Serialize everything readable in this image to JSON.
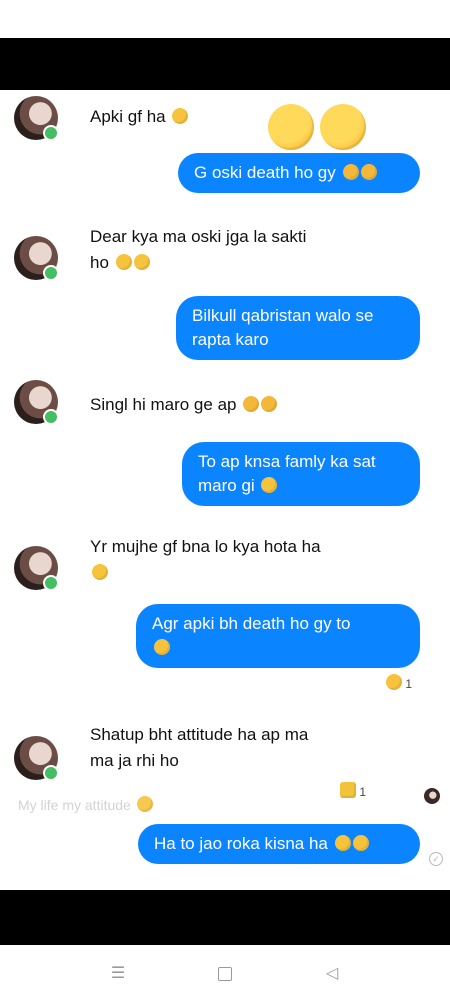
{
  "messages": [
    {
      "id": "m1",
      "side": "in",
      "text": "Apki gf ha"
    },
    {
      "id": "m2",
      "side": "out",
      "text": "G oski death ho gy"
    },
    {
      "id": "m3",
      "side": "in",
      "line1": "Dear kya ma oski jga la sakti",
      "line2": "ho"
    },
    {
      "id": "m4",
      "side": "out",
      "line1": "Bilkull qabristan walo se",
      "line2": "rapta karo"
    },
    {
      "id": "m5",
      "side": "in",
      "text": "Singl hi maro ge ap"
    },
    {
      "id": "m6",
      "side": "out",
      "line1": "To ap knsa famly ka sat",
      "line2": "maro gi"
    },
    {
      "id": "m7",
      "side": "in",
      "text": "Yr mujhe gf bna lo kya hota ha"
    },
    {
      "id": "m8",
      "side": "out",
      "text": "Agr apki bh death ho gy to"
    },
    {
      "id": "m9",
      "side": "in",
      "line1": "Shatup bht attitude ha ap ma",
      "line2": "ma ja rhi ho"
    },
    {
      "id": "m10",
      "side": "out",
      "text": "Ha to jao roka kisna ha"
    }
  ],
  "reactions": {
    "m8_count": "1",
    "m9_count": "1"
  },
  "faint_text": "My life my attitude",
  "icons": [
    "avatar",
    "online-dot",
    "emoji",
    "seen-check",
    "menu-icon",
    "home-icon",
    "back-icon"
  ],
  "colors": {
    "bubble": "#0a84ff",
    "online": "#45bd62"
  }
}
